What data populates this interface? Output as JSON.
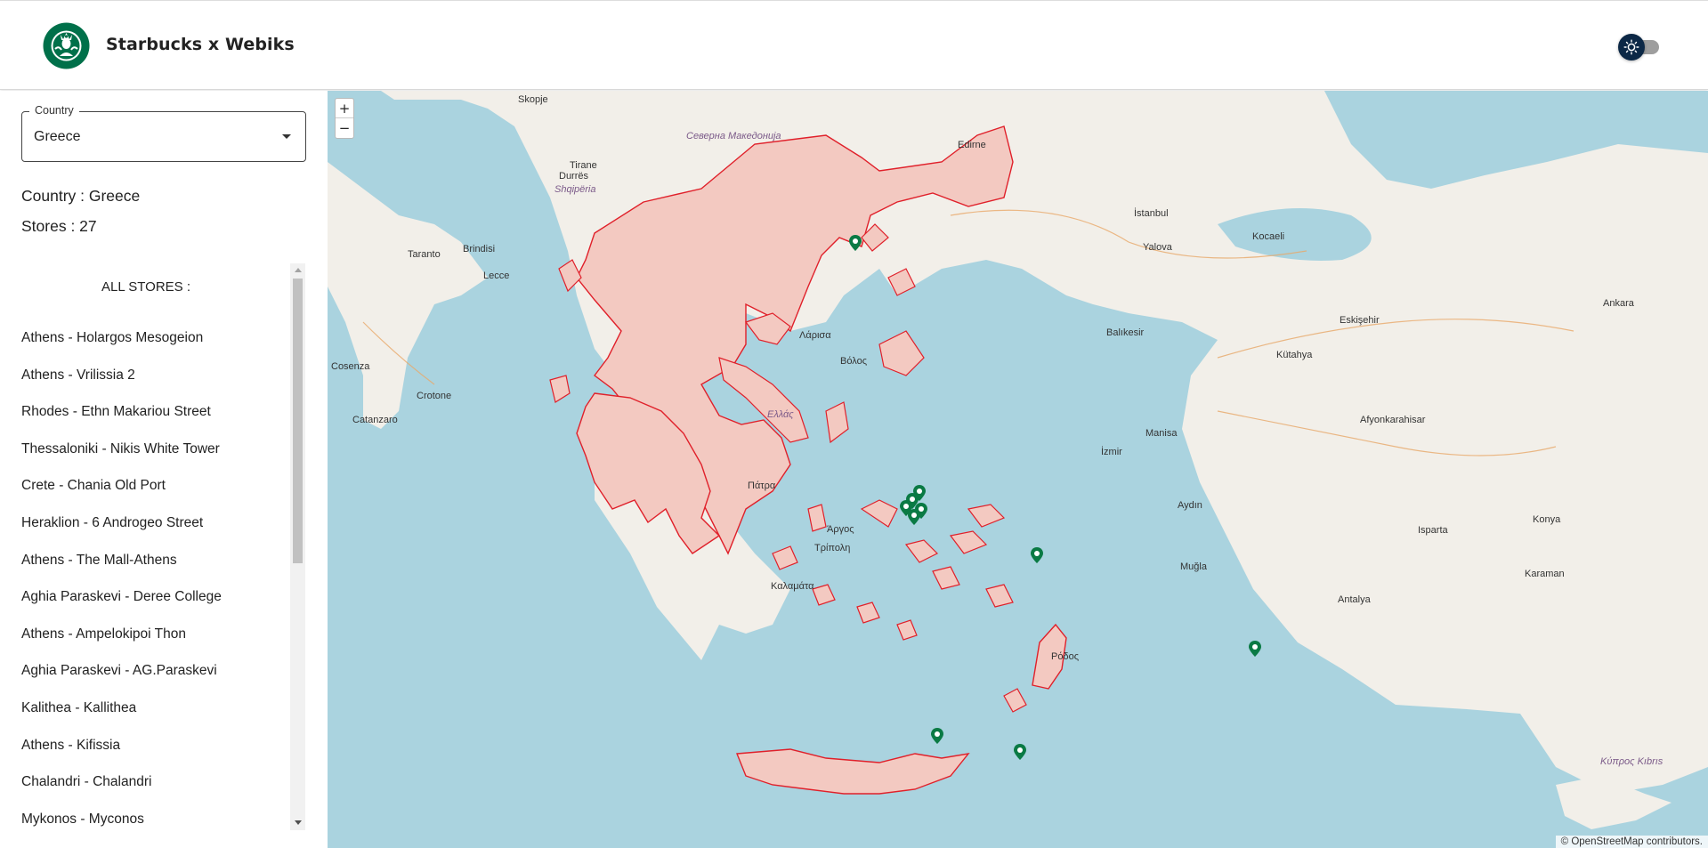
{
  "header": {
    "title": "Starbucks x Webiks",
    "logo_icon": "starbucks-siren-logo",
    "theme_toggle_icon": "sun-icon",
    "theme_toggle_thumb_color": "#0c2846"
  },
  "sidebar": {
    "country_select": {
      "label": "Country",
      "value": "Greece"
    },
    "country_info": "Country : Greece",
    "stores_info": "Stores : 27",
    "list_heading": "ALL STORES :",
    "stores": [
      "Athens - Holargos Mesogeion",
      "Athens - Vrilissia 2",
      "Rhodes - Ethn Makariou Street",
      "Thessaloniki - Nikis White Tower",
      "Crete - Chania Old Port",
      "Heraklion - 6 Androgeo Street",
      "Athens - The Mall-Athens",
      "Aghia Paraskevi - Deree College",
      "Athens - Ampelokipoi Thon",
      "Aghia Paraskevi - AG.Paraskevi",
      "Kalithea - Kallithea",
      "Athens - Kifissia",
      "Chalandri - Chalandri",
      "Mykonos - Myconos"
    ]
  },
  "map": {
    "zoom_in": "+",
    "zoom_out": "−",
    "attribution": "© OpenStreetMap contributors.",
    "colors": {
      "sea": "#aad3df",
      "land": "#f2efe9",
      "greece_fill": "#f3c9c1",
      "greece_border": "#e0202a",
      "marker": "#0a7a44"
    },
    "labels": [
      {
        "text": "Skopje",
        "kind": "city"
      },
      {
        "text": "Северна Македонија",
        "kind": "country"
      },
      {
        "text": "Shqipëria",
        "kind": "country"
      },
      {
        "text": "Tirane",
        "kind": "city"
      },
      {
        "text": "Edirne",
        "kind": "city"
      },
      {
        "text": "İstanbul",
        "kind": "city"
      },
      {
        "text": "Kocaeli",
        "kind": "city"
      },
      {
        "text": "Yalova",
        "kind": "city"
      },
      {
        "text": "Balıkesir",
        "kind": "city"
      },
      {
        "text": "Eskişehir",
        "kind": "city"
      },
      {
        "text": "Ankara",
        "kind": "city"
      },
      {
        "text": "Kütahya",
        "kind": "city"
      },
      {
        "text": "Manisa",
        "kind": "city"
      },
      {
        "text": "İzmir",
        "kind": "city"
      },
      {
        "text": "Afyonkarahisar",
        "kind": "city"
      },
      {
        "text": "Aydın",
        "kind": "city"
      },
      {
        "text": "Muğla",
        "kind": "city"
      },
      {
        "text": "Isparta",
        "kind": "city"
      },
      {
        "text": "Konya",
        "kind": "city"
      },
      {
        "text": "Antalya",
        "kind": "city"
      },
      {
        "text": "Karaman",
        "kind": "city"
      },
      {
        "text": "Κύπρος Kıbrıs",
        "kind": "country"
      },
      {
        "text": "Ελλάς",
        "kind": "country"
      },
      {
        "text": "Πάτρα",
        "kind": "city"
      },
      {
        "text": "Λάρισα",
        "kind": "city"
      },
      {
        "text": "Βόλος",
        "kind": "city"
      },
      {
        "text": "Καλαμάτα",
        "kind": "city"
      },
      {
        "text": "Άργος",
        "kind": "city"
      },
      {
        "text": "Τρίπολη",
        "kind": "city"
      },
      {
        "text": "Ρόδος",
        "kind": "city"
      },
      {
        "text": "Cosenza",
        "kind": "city"
      },
      {
        "text": "Crotone",
        "kind": "city"
      },
      {
        "text": "Catanzaro",
        "kind": "city"
      },
      {
        "text": "Brindisi",
        "kind": "city"
      },
      {
        "text": "Lecce",
        "kind": "city"
      },
      {
        "text": "Taranto",
        "kind": "city"
      },
      {
        "text": "Durrës",
        "kind": "city"
      }
    ],
    "store_markers_icon": "starbucks-store-marker-icon"
  }
}
